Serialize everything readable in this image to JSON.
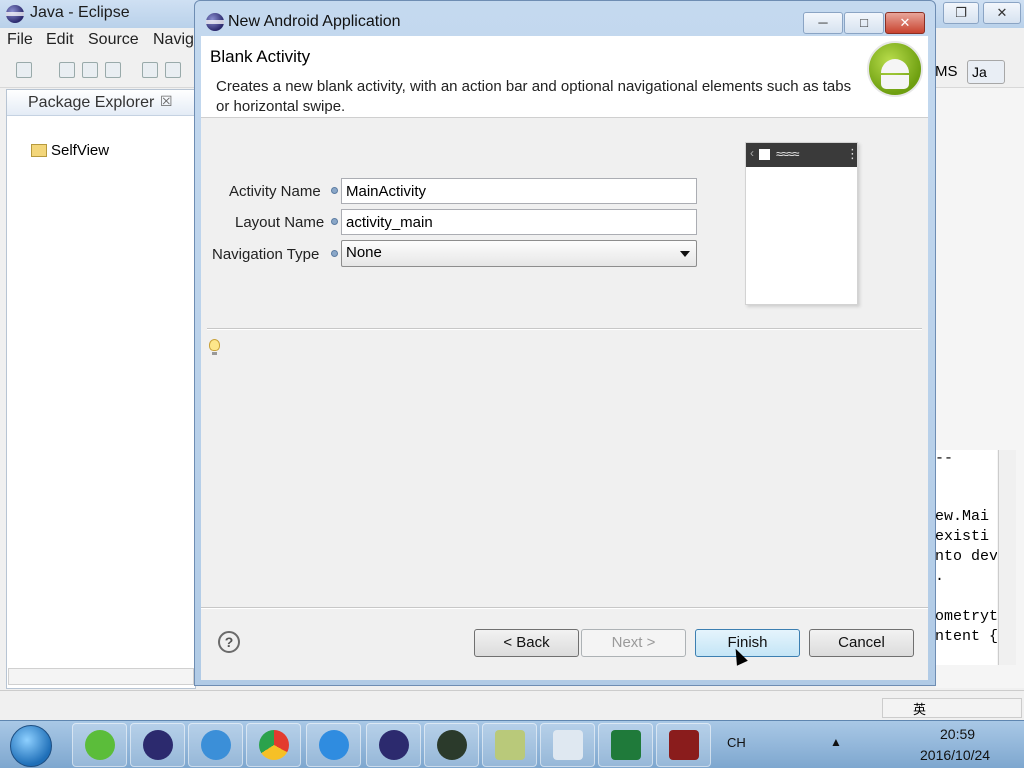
{
  "eclipse": {
    "window_title": "Java - Eclipse",
    "menus": [
      "File",
      "Edit",
      "Source",
      "Navig"
    ],
    "package_explorer": {
      "tab_label": "Package Explorer",
      "close_glyph": "☒",
      "projects": [
        "SelfView"
      ]
    },
    "perspective_label": "MS",
    "java_perspective_tab": "Ja",
    "console_lines": [
      "--",
      "",
      "ew.Mai",
      "existi",
      "nto dev",
      ".",
      "",
      "ometryt",
      "ntent {"
    ]
  },
  "dialog": {
    "title": "New Android Application",
    "header": {
      "title": "Blank Activity",
      "description": "Creates a new blank activity, with an action bar and optional navigational elements such as tabs or horizontal swipe."
    },
    "fields": {
      "activity_name": {
        "label": "Activity Name",
        "value": "MainActivity"
      },
      "layout_name": {
        "label": "Layout Name",
        "value": "activity_main"
      },
      "navigation_type": {
        "label": "Navigation Type",
        "value": "None"
      }
    },
    "buttons": {
      "back": "< Back",
      "next": "Next >",
      "finish": "Finish",
      "cancel": "Cancel"
    },
    "help_glyph": "?"
  },
  "taskbar": {
    "apps": [
      "ie",
      "eclipse",
      "network",
      "chrome",
      "cloud",
      "eclipse2",
      "android-sdk",
      "notes",
      "notepad",
      "excel",
      "camera"
    ],
    "tray_lang": "CH",
    "clock": {
      "time": "20:59",
      "date": "2016/10/24"
    }
  },
  "ime": {
    "lang": "英"
  },
  "colors": {
    "dialog_frame": "#b1cbe6",
    "android_green": "#a4c639",
    "finish_default": "#c4e5f6"
  }
}
